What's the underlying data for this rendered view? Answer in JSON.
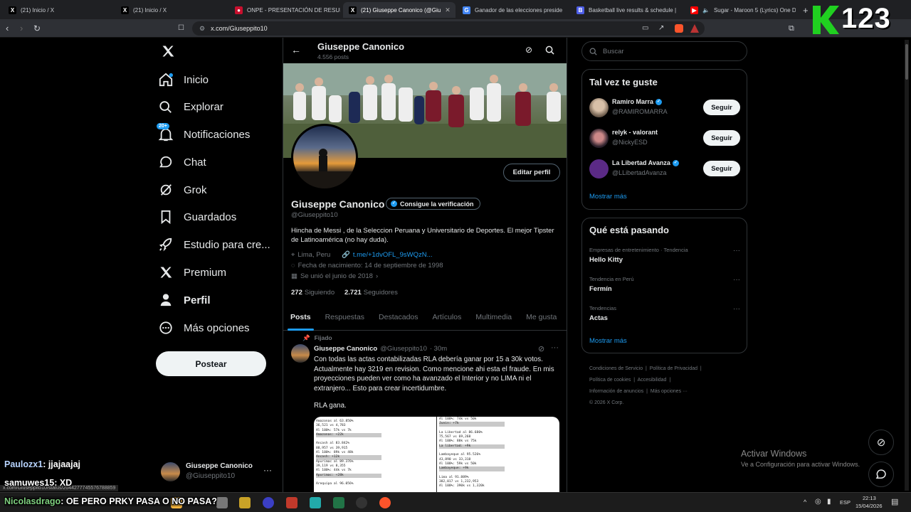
{
  "browser": {
    "tabs": [
      {
        "title": "(21) Inicio / X",
        "icon": "x-logo-icon"
      },
      {
        "title": "(21) Inicio / X",
        "icon": "x-logo-icon"
      },
      {
        "title": "ONPE - PRESENTACIÓN DE RESULT",
        "icon": "onpe-icon"
      },
      {
        "title": "(21) Giuseppe Canonico (@Giu",
        "icon": "x-logo-icon"
      },
      {
        "title": "Ganador de las elecciones preside",
        "icon": "search-icon"
      },
      {
        "title": "Basketball live results & schedule |",
        "icon": "basketball-icon"
      },
      {
        "title": "Sugar - Maroon 5 (Lyrics) One D",
        "icon": "youtube-icon"
      }
    ],
    "url": "x.com/Giuseppito10",
    "overlay_logo": "123"
  },
  "sidebar": {
    "items": [
      {
        "label": "Inicio"
      },
      {
        "label": "Explorar"
      },
      {
        "label": "Notificaciones",
        "badge": "20+"
      },
      {
        "label": "Chat"
      },
      {
        "label": "Grok"
      },
      {
        "label": "Guardados"
      },
      {
        "label": "Estudio para cre..."
      },
      {
        "label": "Premium"
      },
      {
        "label": "Perfil"
      },
      {
        "label": "Más opciones"
      }
    ],
    "post_label": "Postear",
    "account": {
      "name": "Giuseppe Canonico",
      "handle": "@Giuseppito10"
    }
  },
  "profile": {
    "header_name": "Giuseppe Canonico",
    "header_posts": "4.556 posts",
    "edit_label": "Editar perfil",
    "name": "Giuseppe Canonico",
    "verify_label": "Consigue la verificación",
    "handle": "@Giuseppito10",
    "bio": "Hincha de Messi , de la Seleccion Peruana y Universitario de Deportes. El mejor Tipster de Latinoamérica (no hay duda).",
    "location": "Lima, Peru",
    "link": "t.me/+1dvOFL_9sWQzN...",
    "birthday": "Fecha de nacimiento: 14 de septiembre de 1998",
    "joined": "Se unió el junio de 2018",
    "following_count": "272",
    "following_label": "Siguiendo",
    "followers_count": "2.721",
    "followers_label": "Seguidores",
    "tabs": [
      "Posts",
      "Respuestas",
      "Destacados",
      "Artículos",
      "Multimedia",
      "Me gusta"
    ]
  },
  "post": {
    "pinned": "Fijado",
    "author": "Giuseppe Canonico",
    "handle": "@Giuseppito10",
    "time": "· 30m",
    "text": "Con todas las actas contabilizadas RLA debería ganar por 15 a 30k votos. Actualmente hay 3219 en revision. Como mencione ahi esta el fraude. En mis proyecciones pueden ver como ha avanzado el Interior y no LIMA ni el extranjero... Esto para crear incertidumbre.",
    "text2": "RLA gana.",
    "image_left": [
      "Amazonas al 63.850%",
      "36,521 vs 4,783",
      "Al 100%: 57k vs 7k",
      "Amazonas: +22k",
      "",
      "Ancash al 83.842%",
      "88,957 vs 39,915",
      "Al 100%: 89k vs 48k",
      "Ancash: +12k",
      "Apurimac al 89.376%",
      "39,119 vs 8,355",
      "Al 100%: 44k vs 7k",
      "Apurimac: +28k",
      "",
      "Arequipa al 96.056%"
    ],
    "image_right": [
      "Al 100%: 74k vs 50k",
      "Junin: +7k",
      "",
      "La Libertad al 86.680%",
      "75,567 vs 69,268",
      "Al 100%: 88k vs 75k",
      "La libertad: +9k",
      "",
      "Lambayeque al 95.526%",
      "43,890 vs 33,318",
      "Al 100%: 59k vs 50k",
      "Lambayeque: +9k",
      "",
      "Lima al 91.889%",
      "382,017 vs 1,232,953",
      "Al 100%: 390k vs 1,320k"
    ]
  },
  "right": {
    "search_placeholder": "Buscar",
    "suggest_title": "Tal vez te guste",
    "suggestions": [
      {
        "name": "Ramiro Marra",
        "handle": "@RAMIROMARRA",
        "verified": true,
        "follow": "Seguir"
      },
      {
        "name": "relyk - valorant",
        "handle": "@NickyESD",
        "verified": false,
        "follow": "Seguir"
      },
      {
        "name": "La Libertad Avanza",
        "handle": "@LLibertadAvanza",
        "verified": true,
        "follow": "Seguir"
      }
    ],
    "show_more": "Mostrar más",
    "trends_title": "Qué está pasando",
    "trends": [
      {
        "meta": "Empresas de entretenimiento · Tendencia",
        "title": "Hello Kitty"
      },
      {
        "meta": "Tendencia en Perú",
        "title": "Fermín"
      },
      {
        "meta": "Tendencias",
        "title": "Actas"
      }
    ],
    "trends_more": "Mostrar más",
    "footer": [
      "Condiciones de Servicio",
      "Política de Privacidad",
      "Política de cookies",
      "Accesibilidad",
      "Información de anuncios",
      "Más opciones ···",
      "© 2026 X Corp."
    ]
  },
  "overlay": {
    "activate_title": "Activar Windows",
    "activate_sub": "Ve a Configuración para activar Windows.",
    "chat": [
      {
        "user": "Paulozx1",
        "msg": ": jjajaajaj"
      },
      {
        "user": "samuwes15",
        "msg": ": XD"
      },
      {
        "user": "Nicolasdrago",
        "msg": ": OE PERO PRKY PASA O NO PASA?"
      }
    ],
    "status_url": "x.com/Giuseppito10/status/2044277745576788859"
  },
  "taskbar": {
    "lang": "ESP",
    "time": "22:13",
    "date": "15/04/2026"
  },
  "colors": {
    "accent": "#1d9bf0",
    "bg": "#000000",
    "border": "#2f3336",
    "muted": "#71767b"
  }
}
